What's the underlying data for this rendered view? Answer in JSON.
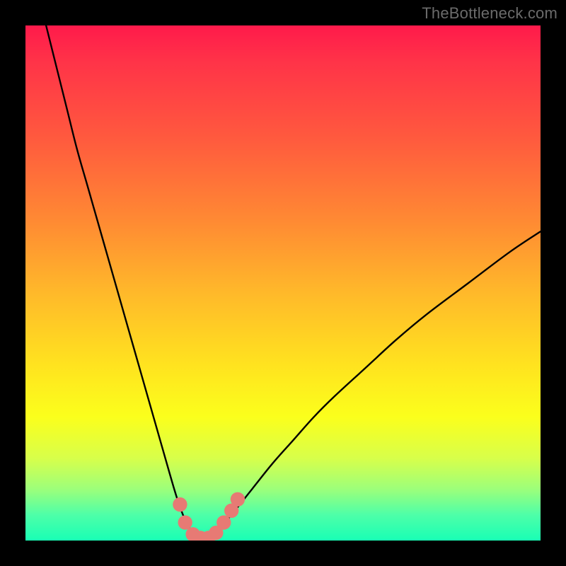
{
  "watermark": "TheBottleneck.com",
  "colors": {
    "frame": "#000000",
    "curve": "#000000",
    "marker": "#e77a74",
    "gradient_stops": [
      "#ff1a4b",
      "#ff3348",
      "#ff5a3e",
      "#ff8a33",
      "#ffb92a",
      "#ffe31f",
      "#fbff1c",
      "#d8ff4a",
      "#9dff7a",
      "#4effa8",
      "#19ffb5"
    ]
  },
  "chart_data": {
    "type": "line",
    "title": "",
    "xlabel": "",
    "ylabel": "",
    "xlim": [
      0,
      100
    ],
    "ylim": [
      0,
      100
    ],
    "series": [
      {
        "name": "bottleneck-curve",
        "x": [
          4,
          6,
          8,
          10,
          12,
          14,
          16,
          18,
          20,
          22,
          24,
          26,
          28,
          29.5,
          31,
          32.5,
          34,
          35.5,
          37,
          40,
          44,
          48,
          52,
          56,
          60,
          66,
          72,
          78,
          86,
          94,
          100
        ],
        "y": [
          100,
          92,
          84,
          76,
          69,
          62,
          55,
          48,
          41,
          34,
          27,
          20,
          13,
          8,
          4,
          1.5,
          0,
          0,
          1.5,
          5,
          10,
          15,
          19.5,
          24,
          28,
          33.5,
          39,
          44,
          50,
          56,
          60
        ]
      }
    ],
    "markers": {
      "name": "highlight-dots",
      "points": [
        {
          "x": 30.0,
          "y": 7.0
        },
        {
          "x": 31.0,
          "y": 3.5
        },
        {
          "x": 32.5,
          "y": 1.2
        },
        {
          "x": 34.0,
          "y": 0.5
        },
        {
          "x": 35.5,
          "y": 0.5
        },
        {
          "x": 37.0,
          "y": 1.5
        },
        {
          "x": 38.5,
          "y": 3.5
        },
        {
          "x": 40.0,
          "y": 5.8
        },
        {
          "x": 41.2,
          "y": 8.0
        }
      ],
      "radius_data_units": 1.4
    }
  }
}
